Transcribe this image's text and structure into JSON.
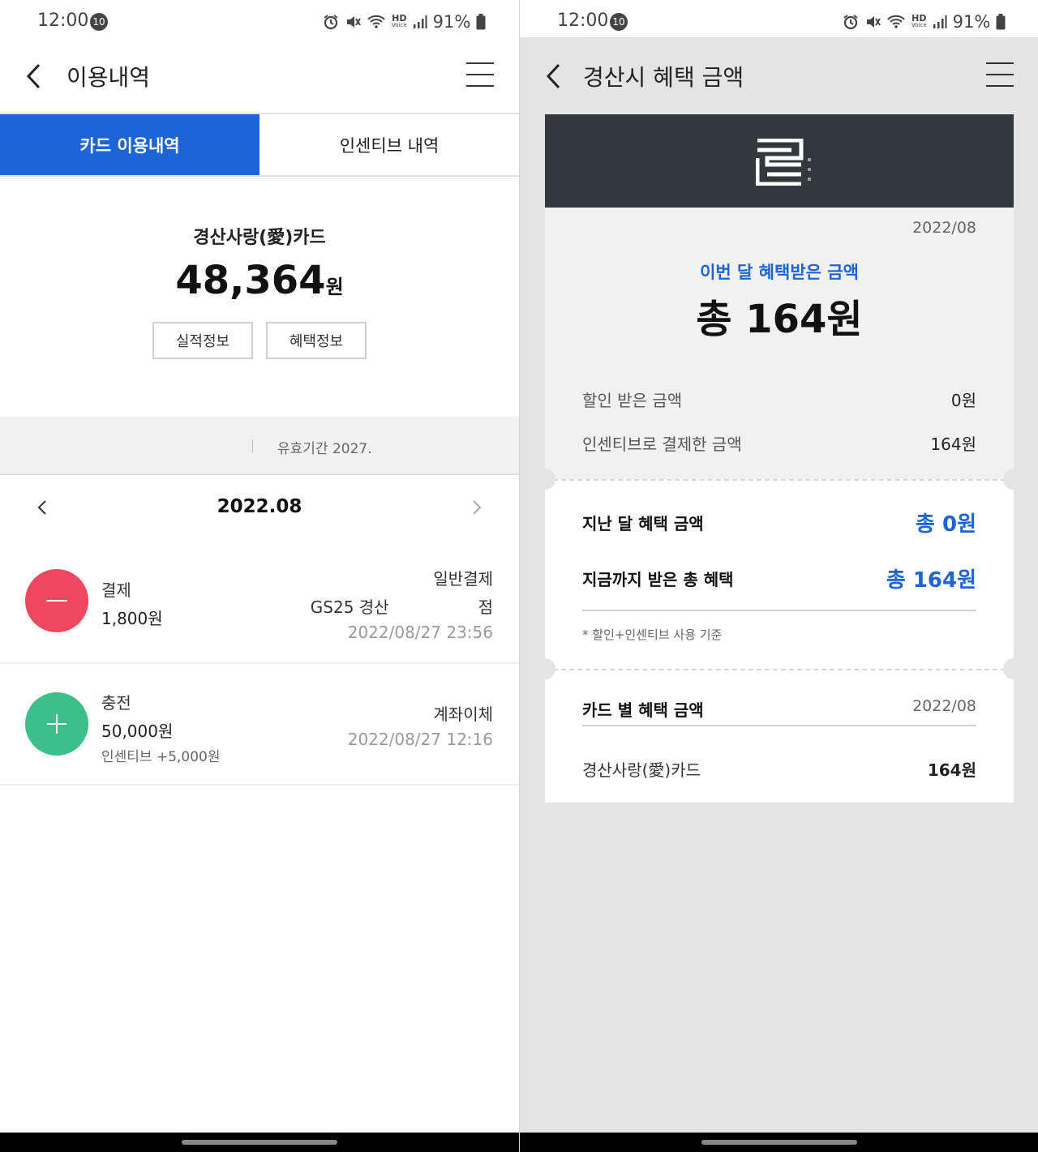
{
  "status_bar": {
    "time": "12:00",
    "notification_count": "10",
    "hd_label": "HD",
    "voice_label": "Voice",
    "battery": "91%"
  },
  "left": {
    "title": "이용내역",
    "tabs": [
      {
        "label": "카드 이용내역",
        "active": true
      },
      {
        "label": "인센티브 내역",
        "active": false
      }
    ],
    "card_name": "경산사랑(愛)카드",
    "balance_value": "48,364",
    "balance_unit": "원",
    "buttons": {
      "performance": "실적정보",
      "benefits": "혜택정보"
    },
    "validity": "유효기간 2027.",
    "month": "2022.08",
    "transactions": [
      {
        "kind": "minus",
        "color": "#f14660",
        "type": "결제",
        "amount": "1,800원",
        "method": "일반결제",
        "store_line1": "GS25 경산",
        "store_line2": "점",
        "date": "2022/08/27 23:56"
      },
      {
        "kind": "plus",
        "color": "#3cc08a",
        "type": "충전",
        "amount": "50,000원",
        "incentive": "인센티브 +5,000원",
        "method": "계좌이체",
        "date": "2022/08/27 12:16"
      }
    ]
  },
  "right": {
    "title": "경산시 혜택 금액",
    "logo_icon": "gyeongsan-logo",
    "month": "2022/08",
    "headline": "이번 달 혜택받은 금액",
    "total": "총 164원",
    "rows": [
      {
        "label": "할인 받은 금액",
        "value": "0원"
      },
      {
        "label": "인센티브로 결제한 금액",
        "value": "164원"
      }
    ],
    "last_month_label": "지난 달 혜택 금액",
    "last_month_value": "총 0원",
    "cumulative_label": "지금까지 받은 총 혜택",
    "cumulative_value": "총 164원",
    "note": "* 할인+인센티브 사용 기준",
    "per_card_title": "카드 별 혜택 금액",
    "per_card_month": "2022/08",
    "per_card": [
      {
        "name": "경산사랑(愛)카드",
        "value": "164원"
      }
    ]
  },
  "colors": {
    "accent_blue": "#1d64d8",
    "header_dark": "#32383b",
    "minus_red": "#f14660",
    "plus_green": "#3cc08a"
  }
}
